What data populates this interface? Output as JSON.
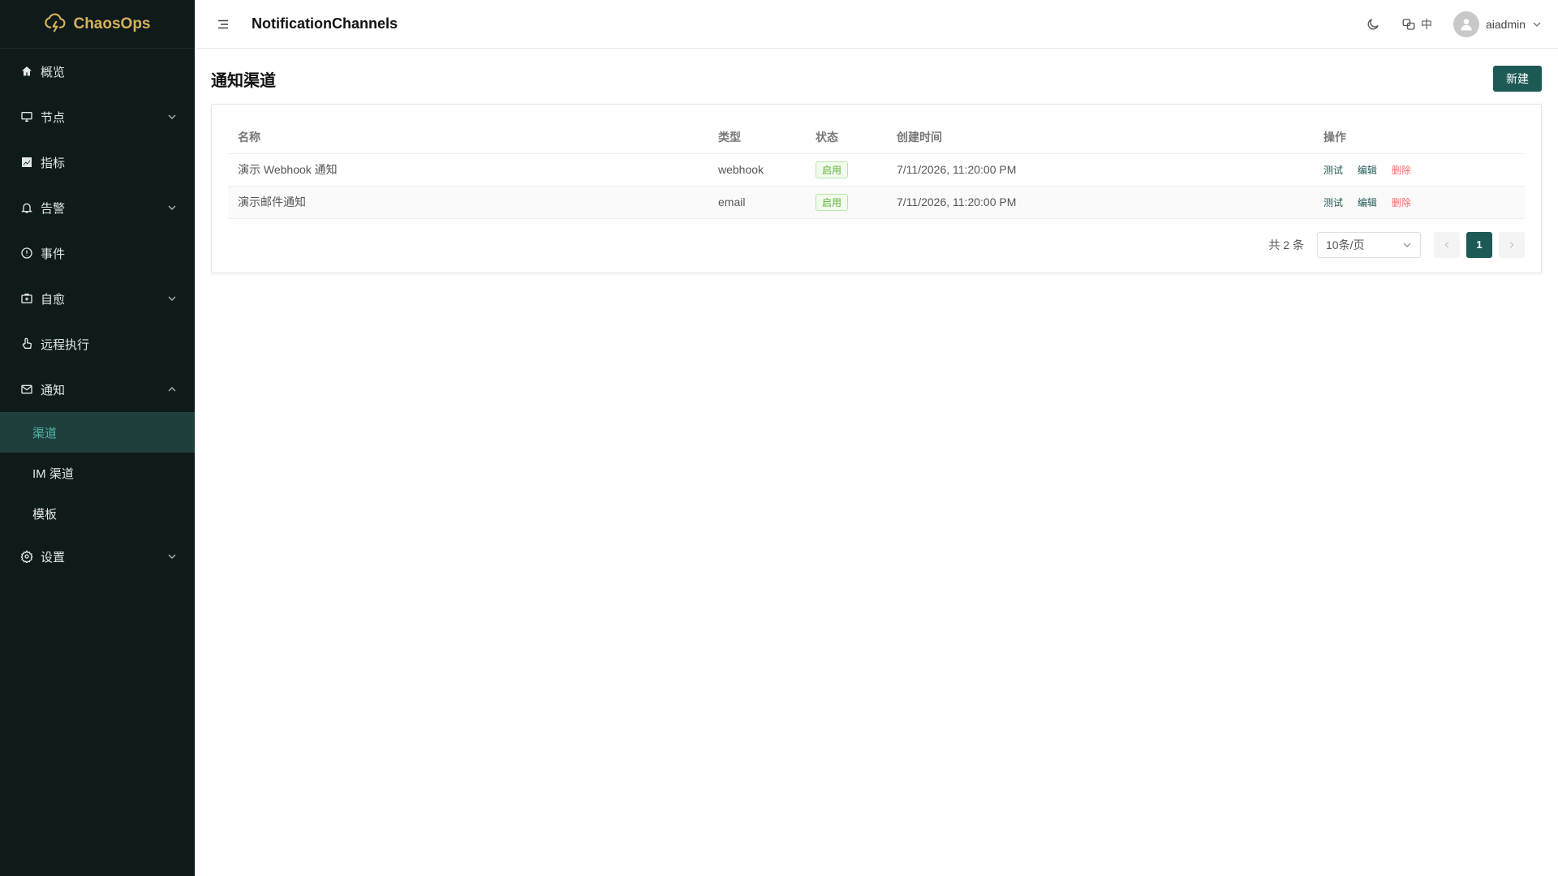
{
  "app": {
    "name": "ChaosOps",
    "brand_color": "#d7b25a",
    "accent": "#1d5a55"
  },
  "sidebar": {
    "items": [
      {
        "label": "概览",
        "icon": "home-icon",
        "expandable": false
      },
      {
        "label": "节点",
        "icon": "monitor-icon",
        "expandable": true,
        "expanded": false
      },
      {
        "label": "指标",
        "icon": "chart-icon",
        "expandable": false
      },
      {
        "label": "告警",
        "icon": "bell-icon",
        "expandable": true,
        "expanded": false
      },
      {
        "label": "事件",
        "icon": "alert-circle-icon",
        "expandable": false
      },
      {
        "label": "自愈",
        "icon": "medkit-icon",
        "expandable": true,
        "expanded": false
      },
      {
        "label": "远程执行",
        "icon": "pointer-icon",
        "expandable": false
      },
      {
        "label": "通知",
        "icon": "mail-icon",
        "expandable": true,
        "expanded": true,
        "children": [
          {
            "label": "渠道",
            "active": true
          },
          {
            "label": "IM 渠道"
          },
          {
            "label": "模板"
          }
        ]
      },
      {
        "label": "设置",
        "icon": "gear-icon",
        "expandable": true,
        "expanded": false
      }
    ]
  },
  "header": {
    "route_title": "NotificationChannels",
    "lang_label": "中",
    "username": "aiadmin"
  },
  "page": {
    "title": "通知渠道",
    "new_button": "新建"
  },
  "table": {
    "columns": [
      "名称",
      "类型",
      "状态",
      "创建时间",
      "操作"
    ],
    "rows": [
      {
        "name": "演示 Webhook 通知",
        "type": "webhook",
        "status": "启用",
        "created": "7/11/2026, 11:20:00 PM"
      },
      {
        "name": "演示邮件通知",
        "type": "email",
        "status": "启用",
        "created": "7/11/2026, 11:20:00 PM"
      }
    ],
    "actions": {
      "test": "测试",
      "edit": "编辑",
      "delete": "删除"
    }
  },
  "pagination": {
    "total_label": "共 2 条",
    "page_size": "10条/页",
    "current_page": "1"
  }
}
